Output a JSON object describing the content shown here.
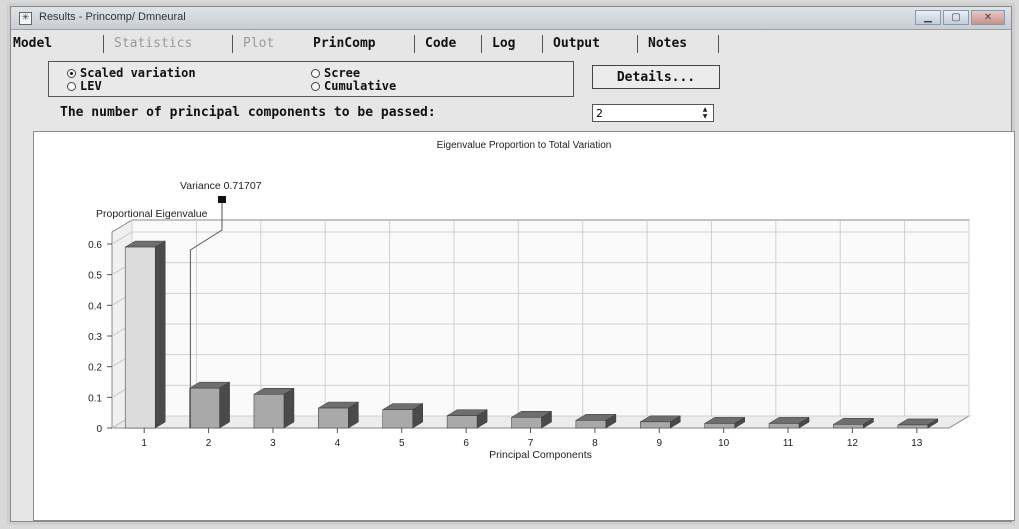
{
  "window": {
    "title": "Results - Princomp/ Dmneural",
    "app_icon": "sas-results-icon",
    "buttons": [
      "minimize",
      "maximize",
      "close"
    ]
  },
  "tabs": [
    {
      "label": "Model",
      "enabled": true
    },
    {
      "label": "Statistics",
      "enabled": false
    },
    {
      "label": "Plot",
      "enabled": false
    },
    {
      "label": "PrinComp",
      "enabled": true,
      "selected": true
    },
    {
      "label": "Code",
      "enabled": true
    },
    {
      "label": "Log",
      "enabled": true
    },
    {
      "label": "Output",
      "enabled": true
    },
    {
      "label": "Notes",
      "enabled": true
    }
  ],
  "options": {
    "scaled_variation": "Scaled variation",
    "lev": "LEV",
    "scree": "Scree",
    "cumulative": "Cumulative",
    "selected": "Scaled variation"
  },
  "details_button": "Details...",
  "components": {
    "label": "The number of principal components to be passed:",
    "value": "2"
  },
  "chart_data": {
    "type": "bar",
    "title": "Eigenvalue Proportion to Total Variation",
    "xlabel": "Principal Components",
    "ylabel": "Proportional Eigenvalue",
    "categories": [
      "1",
      "2",
      "3",
      "4",
      "5",
      "6",
      "7",
      "8",
      "9",
      "10",
      "11",
      "12",
      "13"
    ],
    "values": [
      0.59,
      0.13,
      0.11,
      0.065,
      0.06,
      0.04,
      0.035,
      0.025,
      0.02,
      0.015,
      0.015,
      0.012,
      0.01
    ],
    "ylim": [
      0,
      0.6
    ],
    "yticks": [
      "0",
      "0.1",
      "0.2",
      "0.3",
      "0.4",
      "0.5",
      "0.6"
    ],
    "grid": true,
    "annotation": {
      "label": "Variance 0.71707",
      "component": "2"
    },
    "colors": {
      "bar_front": "#a9a9a9",
      "bar_top": "#6e6e6e",
      "bar_side": "#4a4a4a",
      "highlight": "#dcdcdc"
    }
  }
}
